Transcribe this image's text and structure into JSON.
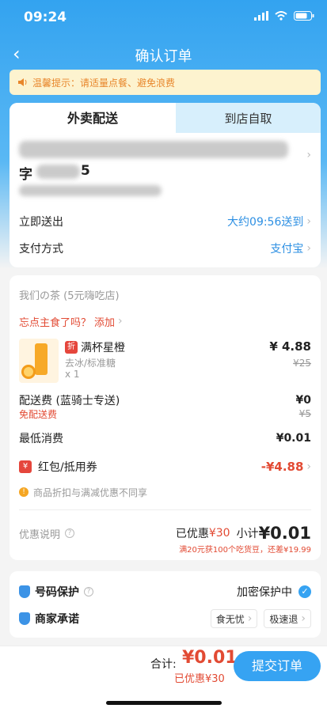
{
  "status": {
    "time": "09:24"
  },
  "nav": {
    "back_icon": "‹",
    "title": "确认订单"
  },
  "tip": {
    "text": "温馨提示：请适量点餐、避免浪费"
  },
  "tabs": {
    "delivery": "外卖配送",
    "pickup": "到店自取"
  },
  "delivery": {
    "addr_line2": "字",
    "addr_tail": "5",
    "time_label": "立即送出",
    "time_value": "大约09:56送到",
    "pay_label": "支付方式",
    "pay_value": "支付宝"
  },
  "shop": {
    "name": "我们の茶 (5元嗨吃店)",
    "forgot": "忘点主食了吗？",
    "add": "添加"
  },
  "item": {
    "badge": "折",
    "name": "满杯星橙",
    "spec": "去冰/标准糖",
    "qty": "x 1",
    "price": "¥ 4.88",
    "orig": "¥25"
  },
  "fees": {
    "delivery_label": "配送费 (蓝骑士专送)",
    "delivery_value": "¥0",
    "delivery_note": "免配送费",
    "delivery_orig": "¥5",
    "min_label": "最低消费",
    "min_value": "¥0.01",
    "coupon_label": "红包/抵用券",
    "coupon_value": "-¥4.88",
    "notice": "商品折扣与满减优惠不同享"
  },
  "summary": {
    "discount_label": "优惠说明",
    "discounted_prefix": "已优惠",
    "discounted": "¥30",
    "subtotal_label": "小计",
    "subtotal": "¥0.01",
    "promo": "满20元获100个吃货豆，还差¥19.99"
  },
  "protect": {
    "number_label": "号码保护",
    "number_status": "加密保护中",
    "merchant_label": "商家承诺",
    "tag1": "食无忧",
    "tag2": "极速退"
  },
  "bottom": {
    "total_label": "合计:",
    "total": "¥0.01",
    "saved": "已优惠¥30",
    "submit": "提交订单"
  },
  "colors": {
    "primary": "#36a3f2",
    "red": "#e24a33"
  }
}
